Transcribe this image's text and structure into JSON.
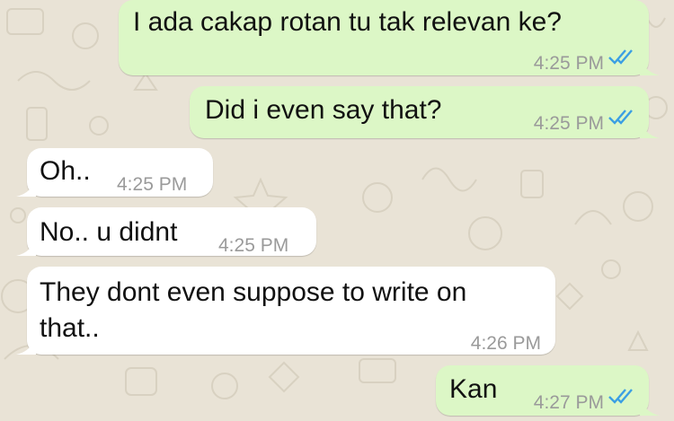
{
  "colors": {
    "outgoing_bubble": "#dcf7c6",
    "incoming_bubble": "#ffffff",
    "read_ticks": "#3b9fe3",
    "timestamp": "#9a9a9a",
    "wallpaper": "#e9e3d6"
  },
  "messages": [
    {
      "direction": "outgoing",
      "text": "I ada cakap rotan tu tak relevan ke?",
      "time": "4:25 PM",
      "status_icon": "double-check-read-icon"
    },
    {
      "direction": "outgoing",
      "text": "Did i even say that?",
      "time": "4:25 PM",
      "status_icon": "double-check-read-icon"
    },
    {
      "direction": "incoming",
      "text": "Oh..",
      "time": "4:25 PM"
    },
    {
      "direction": "incoming",
      "text": "No.. u didnt",
      "time": "4:25 PM"
    },
    {
      "direction": "incoming",
      "text_line1": "They dont even suppose to write on",
      "text_line2": "that..",
      "time": "4:26 PM"
    },
    {
      "direction": "outgoing",
      "text": "Kan",
      "time": "4:27 PM",
      "status_icon": "double-check-read-icon"
    }
  ]
}
